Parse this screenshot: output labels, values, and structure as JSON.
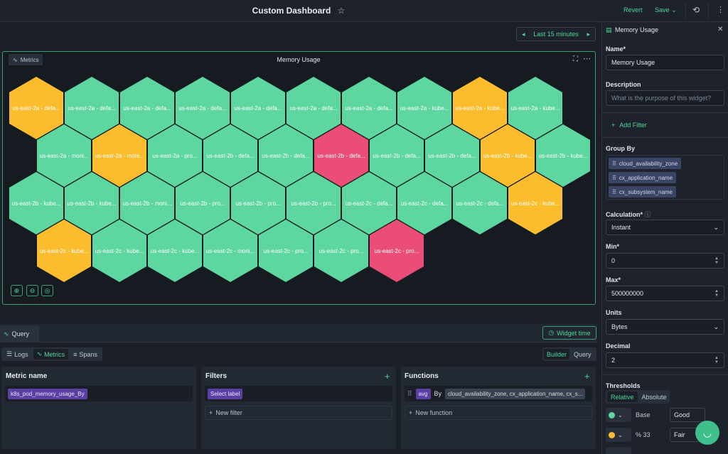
{
  "header": {
    "title": "Custom Dashboard",
    "revert_label": "Revert",
    "save_label": "Save"
  },
  "time_range": {
    "label": "Last 15 minutes"
  },
  "widget": {
    "tag": "Metrics",
    "title": "Memory Usage",
    "colors": {
      "ok": "#5dd6a0",
      "fair": "#fbbd2e",
      "bad": "#ea4d77"
    },
    "hexagons": [
      {
        "label": "us-east-2a - defa...",
        "status": "fair"
      },
      {
        "label": "us-east-2a - defa...",
        "status": "ok"
      },
      {
        "label": "us-east-2a - defa...",
        "status": "ok"
      },
      {
        "label": "us-east-2a - defa...",
        "status": "ok"
      },
      {
        "label": "us-east-2a - defa...",
        "status": "ok"
      },
      {
        "label": "us-east-2a - defa...",
        "status": "ok"
      },
      {
        "label": "us-east-2a - defa...",
        "status": "ok"
      },
      {
        "label": "us-east-2a - kube...",
        "status": "ok"
      },
      {
        "label": "us-east-2a - kube...",
        "status": "fair"
      },
      {
        "label": "us-east-2a - kube...",
        "status": "ok"
      },
      {
        "label": "us-east-2a - moni...",
        "status": "ok"
      },
      {
        "label": "us-east-2a - moni...",
        "status": "fair"
      },
      {
        "label": "us-east-2a - pro...",
        "status": "ok"
      },
      {
        "label": "us-east-2b - defa...",
        "status": "ok"
      },
      {
        "label": "us-east-2b - defa...",
        "status": "ok"
      },
      {
        "label": "us-east-2b - defa...",
        "status": "bad"
      },
      {
        "label": "us-east-2b - defa...",
        "status": "ok"
      },
      {
        "label": "us-east-2b - defa...",
        "status": "ok"
      },
      {
        "label": "us-east-2b - kube...",
        "status": "fair"
      },
      {
        "label": "us-east-2b - kube...",
        "status": "ok"
      },
      {
        "label": "us-east-2b - kube...",
        "status": "ok"
      },
      {
        "label": "us-east-2b - kube...",
        "status": "ok"
      },
      {
        "label": "us-east-2b - moni...",
        "status": "ok"
      },
      {
        "label": "us-east-2b - pro...",
        "status": "ok"
      },
      {
        "label": "us-east-2b - pro...",
        "status": "ok"
      },
      {
        "label": "us-east-2b - pro...",
        "status": "ok"
      },
      {
        "label": "us-east-2c - defa...",
        "status": "ok"
      },
      {
        "label": "us-east-2c - defa...",
        "status": "ok"
      },
      {
        "label": "us-east-2c - defa...",
        "status": "ok"
      },
      {
        "label": "us-east-2c - kube...",
        "status": "fair"
      },
      {
        "label": "us-east-2c - kube...",
        "status": "fair"
      },
      {
        "label": "us-east-2c - kube...",
        "status": "ok"
      },
      {
        "label": "us-east-2c - kube...",
        "status": "ok"
      },
      {
        "label": "us-east-2c - moni...",
        "status": "ok"
      },
      {
        "label": "us-east-2c - pro...",
        "status": "ok"
      },
      {
        "label": "us-east-2c - pro...",
        "status": "ok"
      },
      {
        "label": "us-east-2c - pro...",
        "status": "bad"
      }
    ]
  },
  "query": {
    "tab_label": "Query",
    "widget_time_label": "Widget time",
    "modes": [
      "Logs",
      "Metrics",
      "Spans"
    ],
    "active_mode": "Metrics",
    "builder_label": "Builder",
    "query_label": "Query",
    "metric_panel": {
      "title": "Metric name",
      "value": "k8s_pod_memory_usage_By"
    },
    "filters_panel": {
      "title": "Filters",
      "select_label": "Select label",
      "add_label": "New filter"
    },
    "functions_panel": {
      "title": "Functions",
      "func": "avg",
      "by_label": "By",
      "by_value": "cloud_availability_zone, cx_application_name, cx_s...",
      "add_label": "New function"
    }
  },
  "sidebar": {
    "header": "Memory Usage",
    "name_label": "Name*",
    "name_value": "Memory Usage",
    "description_label": "Description",
    "description_placeholder": "What is the purpose of this widget?",
    "add_filter_label": "Add Filter",
    "group_by_label": "Group By",
    "group_by": [
      "cloud_availability_zone",
      "cx_application_name",
      "cx_subsystem_name"
    ],
    "calculation_label": "Calculation*",
    "calculation_value": "Instant",
    "min_label": "Min*",
    "min_value": "0",
    "max_label": "Max*",
    "max_value": "500000000",
    "units_label": "Units",
    "units_value": "Bytes",
    "decimal_label": "Decimal",
    "decimal_value": "2",
    "thresholds_label": "Thresholds",
    "thresholds_tabs": [
      "Relative",
      "Absolute"
    ],
    "thresholds": [
      {
        "prefix": "",
        "value": "Base",
        "name": "Good",
        "color": "#5dd6a0"
      },
      {
        "prefix": "%",
        "value": "33",
        "name": "Fair",
        "color": "#fbbd2e"
      }
    ]
  }
}
